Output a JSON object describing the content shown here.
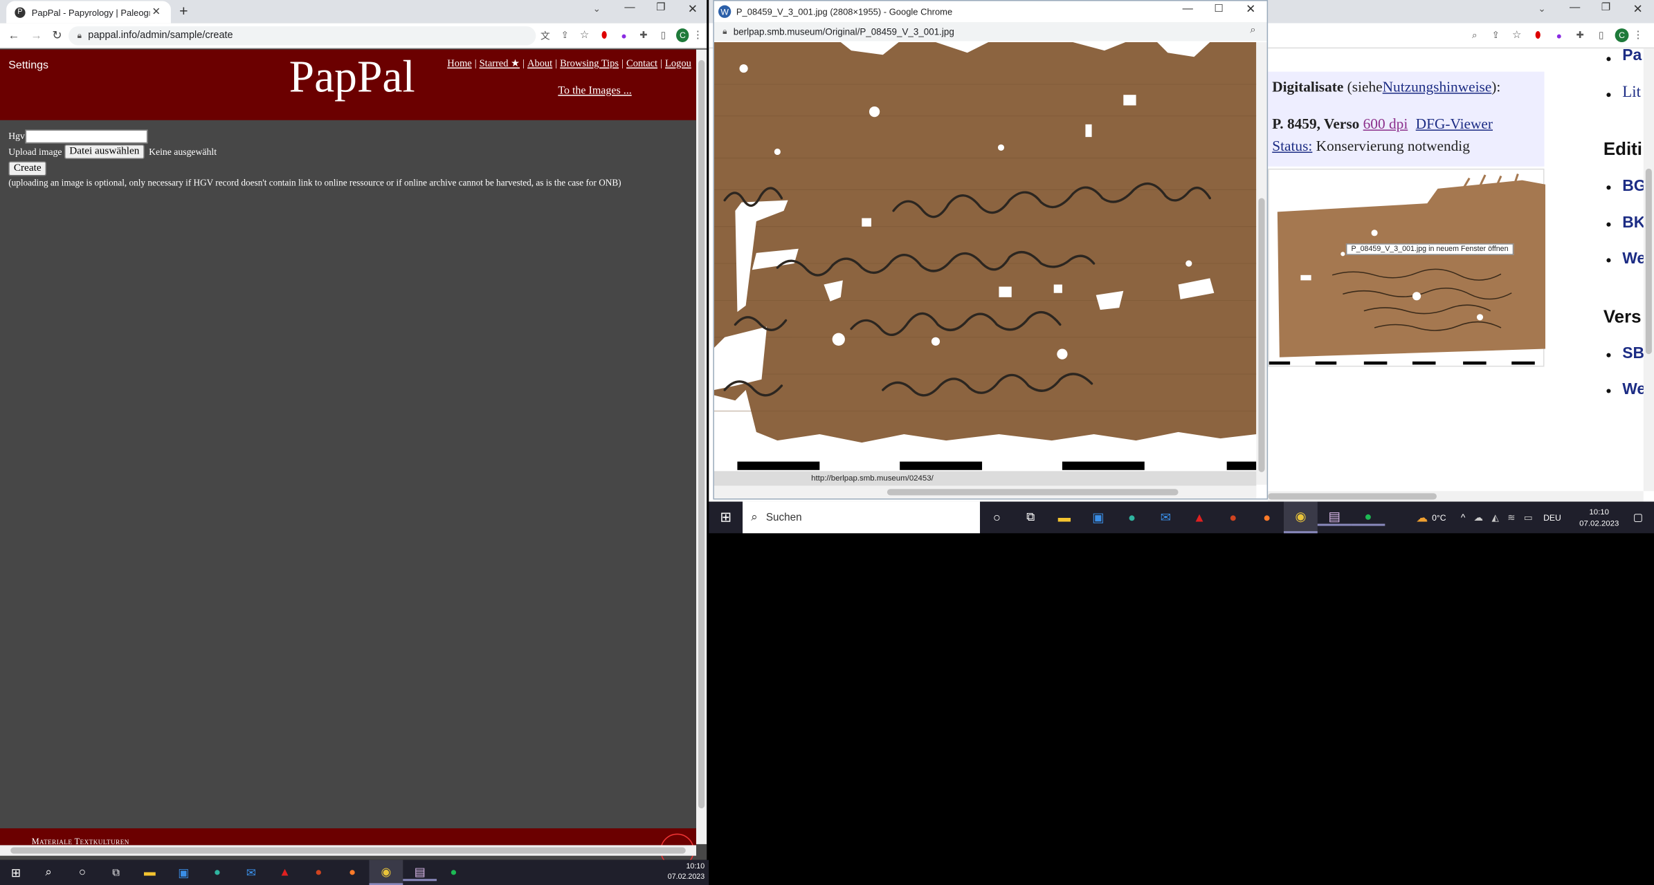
{
  "left": {
    "tab_title": "PapPal - Papyrology | Paleograph",
    "url": "pappal.info/admin/sample/create",
    "settings": "Settings",
    "logo": "PapPal",
    "nav": [
      "Home",
      "|",
      "Starred ★",
      "|",
      "About",
      "|",
      "Browsing Tips",
      "|",
      "Contact",
      "|",
      "Logou"
    ],
    "to_images": "To the Images ...",
    "hgv_label": "Hgv",
    "hgv_value": "",
    "upload_label": "Upload image",
    "file_button": "Datei auswählen",
    "file_status": "Keine ausgewählt",
    "create_button": "Create",
    "note": "(uploading an image is optional, only necessary if HGV record doesn't contain link to online ressource or if online archive cannot be harvested, as is the case for ONB)",
    "footer_text": "Materiale Textkulturen",
    "avatar_letter": "C"
  },
  "popup": {
    "title": "P_08459_V_3_001.jpg (2808×1955) - Google Chrome",
    "url": "berlpap.smb.museum/Original/P_08459_V_3_001.jpg",
    "status_url": "http://berlpap.smb.museum/02453/"
  },
  "right": {
    "digitalisate_label": "Digitalisate",
    "digitalisate_siehe": "(siehe",
    "nutzungshinweise": "Nutzungshinweise",
    "digitalisate_end": "):",
    "record": "P. 8459, Verso",
    "dpi_link": "600 dpi",
    "dfg_link": "DFG-Viewer",
    "status_label": "Status:",
    "status_value": "Konservierung notwendig",
    "tooltip": "P_08459_V_3_001.jpg in neuem Fenster öffnen",
    "sidebar": [
      "Pa",
      "Lit",
      "Editi",
      "BG",
      "BK",
      "We",
      "Vers",
      "SB",
      "We"
    ],
    "bottom_url": "https://berlpap.smb.museum/Original/P_08459_V_3_001.jpg",
    "avatar_letter": "C"
  },
  "taskbar_right": {
    "search": "Suchen",
    "weather": "0°C",
    "lang": "DEU",
    "time": "10:10",
    "date": "07.02.2023"
  },
  "taskbar_left": {
    "time": "10:10",
    "date": "07.02.2023"
  },
  "colors": {
    "pappal_header": "#6b0000",
    "pappal_body": "#474747",
    "papyrus": "#8c6440",
    "taskbar": "#1f1f2b"
  }
}
